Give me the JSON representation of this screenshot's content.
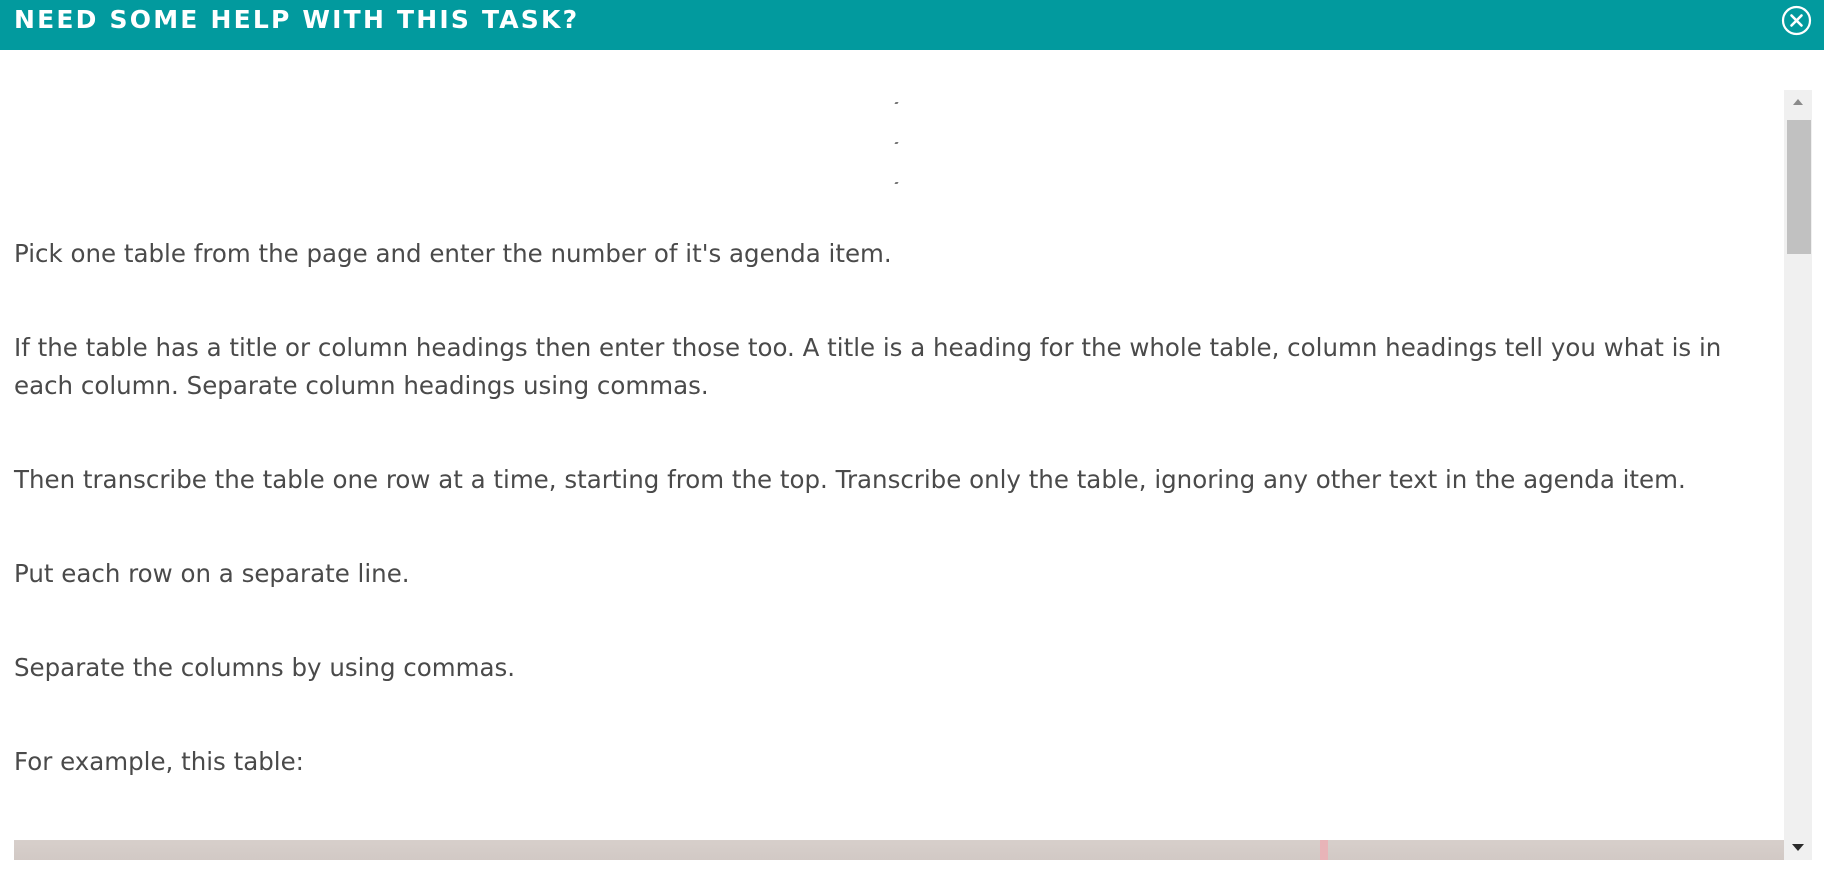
{
  "modal": {
    "title": "NEED SOME HELP WITH THIS TASK?",
    "close_icon": "close-circle-icon"
  },
  "content": {
    "paragraphs": [
      "Pick one table from the page and enter the number of it's agenda item.",
      "If the table has a title or column headings then enter those too. A title is a heading for the whole table, column headings tell you what is in each column. Separate column headings using commas.",
      "Then transcribe the table one row at a time, starting from the top. Transcribe only the table, ignoring any other text in the agenda item.",
      "Put each row on a separate line.",
      "Separate the columns by using commas.",
      "For example, this table:"
    ]
  },
  "scrollbar": {
    "up_icon": "triangle-up-icon",
    "down_icon": "triangle-down-icon"
  },
  "colors": {
    "header_bg": "#029a9e",
    "header_text": "#ffffff",
    "body_text": "#4a4a4a",
    "scrollbar_track": "#f0f0f0",
    "scrollbar_thumb": "#c1c1c1"
  }
}
